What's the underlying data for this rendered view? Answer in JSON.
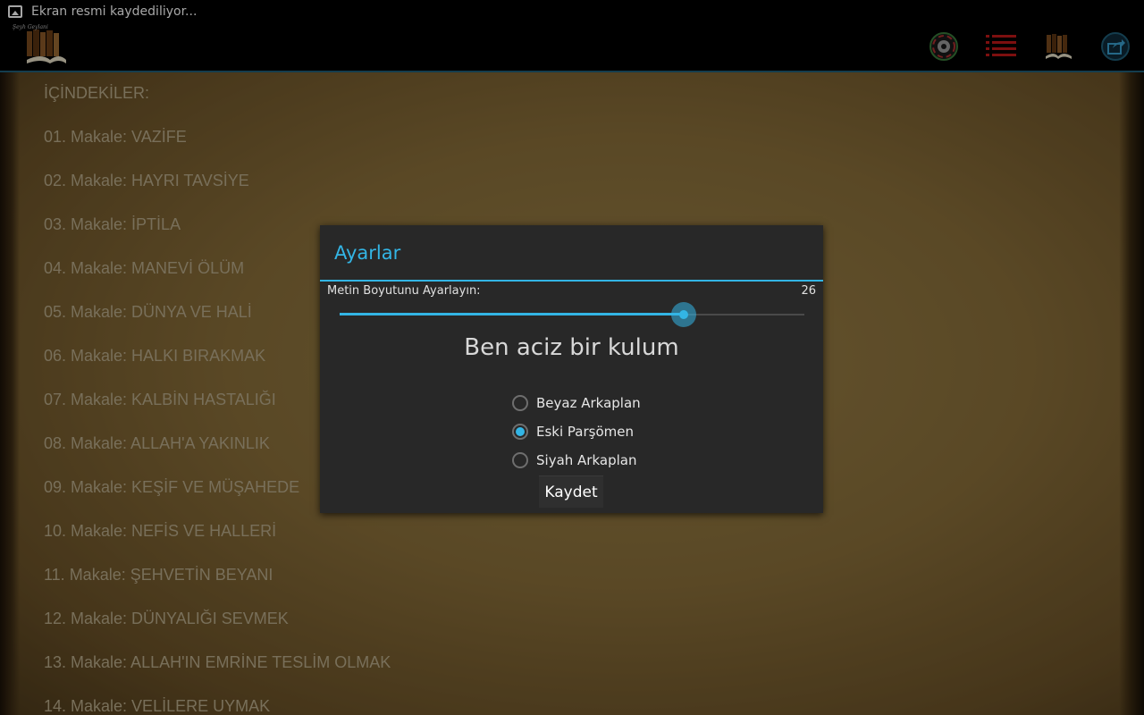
{
  "status_bar": {
    "notification_icon": "screenshot-icon",
    "text": "Ekran resmi kaydediliyor..."
  },
  "action_bar": {
    "logo_caption": "Şeyh Geylani",
    "logo_icon": "books-icon",
    "buttons": [
      {
        "name": "settings-button",
        "icon": "gear-icon"
      },
      {
        "name": "list-button",
        "icon": "list-icon"
      },
      {
        "name": "library-button",
        "icon": "books-icon"
      },
      {
        "name": "share-button",
        "icon": "share-icon"
      }
    ],
    "accent_color": "#33b5e5"
  },
  "toc": {
    "heading": "İÇİNDEKİLER:",
    "items": [
      "01. Makale: VAZİFE",
      "02. Makale: HAYRI TAVSİYE",
      "03. Makale: İPTİLA",
      "04. Makale: MANEVİ ÖLÜM",
      "05. Makale: DÜNYA VE HALİ",
      "06. Makale: HALKI BIRAKMAK",
      "07. Makale: KALBİN HASTALIĞI",
      "08. Makale: ALLAH'A YAKINLIK",
      "09. Makale: KEŞİF VE MÜŞAHEDE",
      "10. Makale: NEFİS VE HALLERİ",
      "11. Makale: ŞEHVETİN BEYANI",
      "12. Makale: DÜNYALIĞI SEVMEK",
      "13. Makale: ALLAH'IN EMRİNE TESLİM OLMAK",
      "14. Makale: VELİLERE UYMAK"
    ]
  },
  "dialog": {
    "title": "Ayarlar",
    "text_size_label": "Metin Boyutunu Ayarlayın:",
    "text_size_value": "26",
    "slider_fraction": 0.74,
    "preview_text": "Ben aciz bir kulum",
    "background_options": [
      {
        "label": "Beyaz Arkaplan",
        "checked": false
      },
      {
        "label": "Eski Parşömen",
        "checked": true
      },
      {
        "label": "Siyah Arkaplan",
        "checked": false
      }
    ],
    "save_label": "Kaydet"
  }
}
